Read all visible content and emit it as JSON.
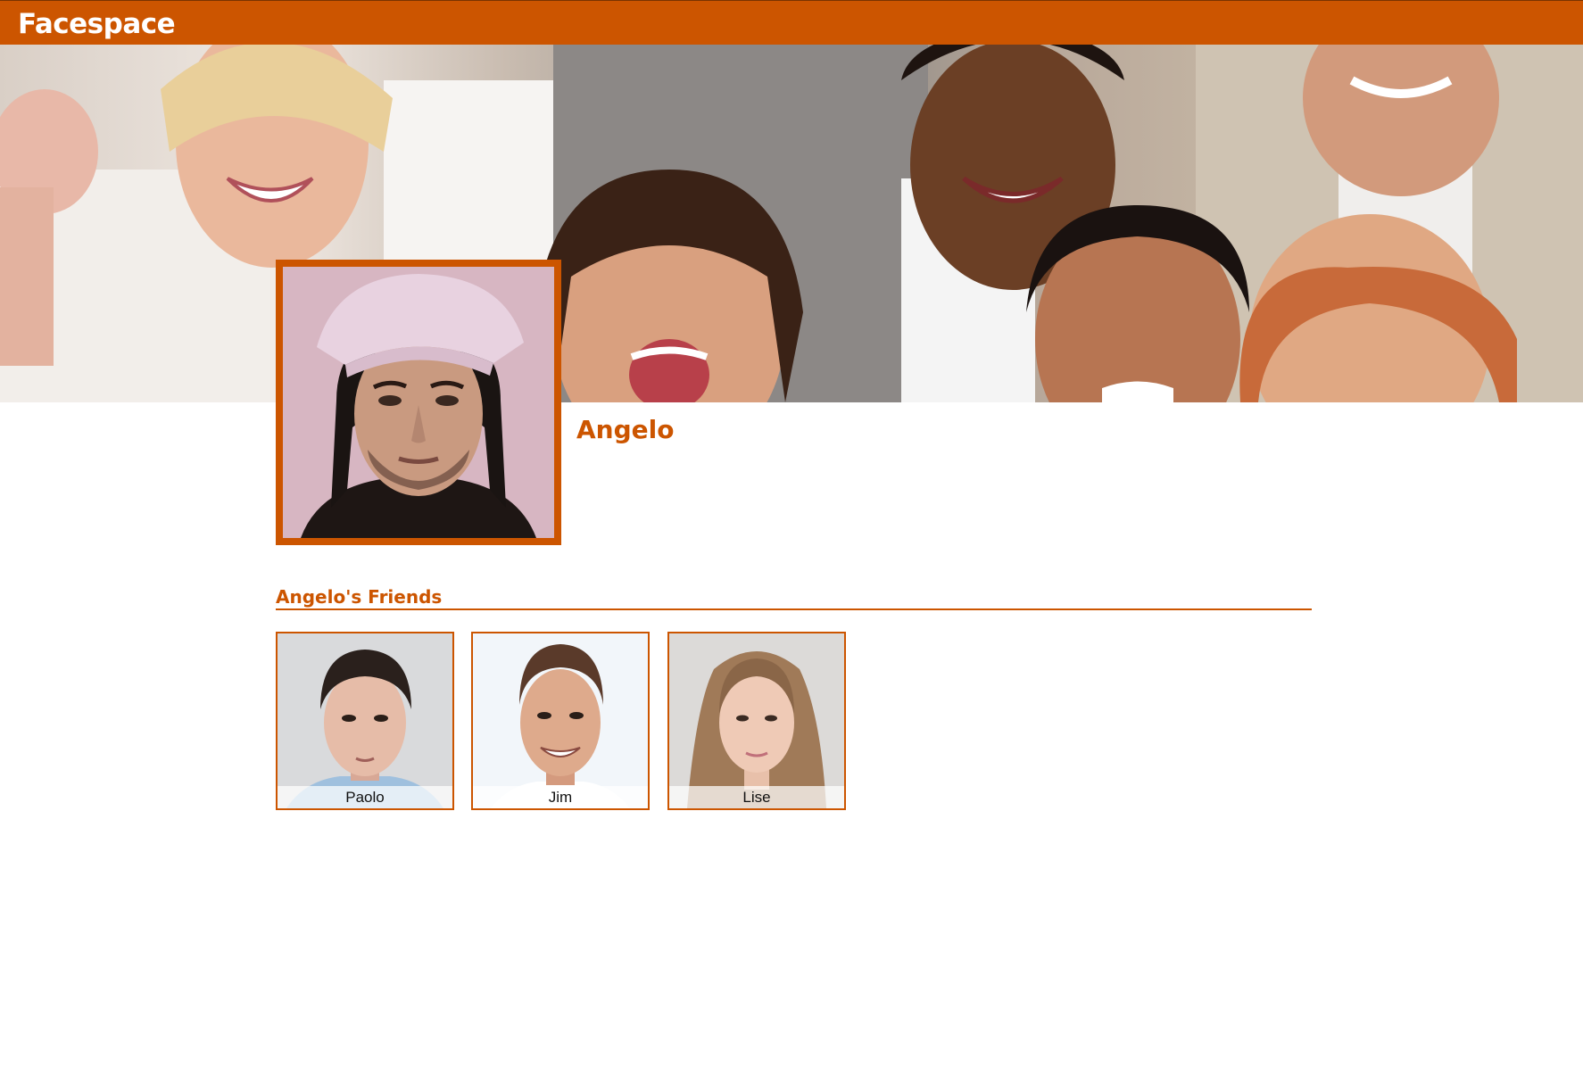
{
  "app": {
    "brand": "Facespace",
    "accent_color": "#cc5500"
  },
  "header": {
    "cover_image": "crowd-of-smiling-people-photo"
  },
  "profile": {
    "name": "Angelo",
    "avatar_image": "young-man-pink-bandana-photo"
  },
  "friends": {
    "heading": "Angelo's Friends",
    "items": [
      {
        "label": "Paolo",
        "image": "dark-haired-man-photo"
      },
      {
        "label": "Jim",
        "image": "smiling-man-photo"
      },
      {
        "label": "Lise",
        "image": "long-haired-woman-photo"
      }
    ]
  }
}
